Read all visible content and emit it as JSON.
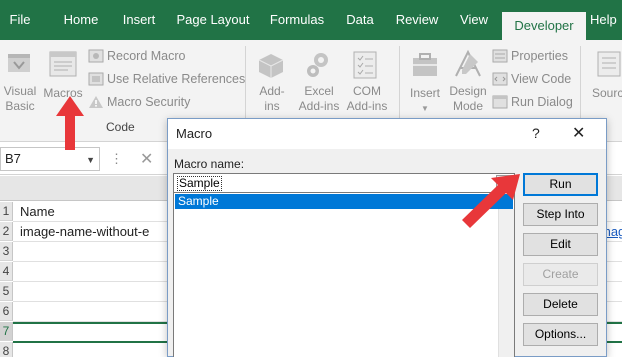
{
  "ribbon_tabs": [
    {
      "label": "File"
    },
    {
      "label": "Home"
    },
    {
      "label": "Insert"
    },
    {
      "label": "Page Layout"
    },
    {
      "label": "Formulas"
    },
    {
      "label": "Data"
    },
    {
      "label": "Review"
    },
    {
      "label": "View"
    },
    {
      "label": "Developer",
      "active": true
    },
    {
      "label": "Help"
    }
  ],
  "ribbon": {
    "visual_basic": "Visual Basic",
    "visual_basic_l1": "Visual",
    "visual_basic_l2": "Basic",
    "macros": "Macros",
    "record_macro": "Record Macro",
    "use_relative_references": "Use Relative References",
    "macro_security": "Macro Security",
    "code_group_label": "Code",
    "addins_l1": "Add-",
    "addins_l2": "ins",
    "excel_addins_l1": "Excel",
    "excel_addins_l2": "Add-ins",
    "com_addins_l1": "COM",
    "com_addins_l2": "Add-ins",
    "insert": "Insert",
    "design_mode_l1": "Design",
    "design_mode_l2": "Mode",
    "properties": "Properties",
    "view_code": "View Code",
    "run_dialog": "Run Dialog",
    "source_partial": "Sourc"
  },
  "formula_bar": {
    "name_box": "B7",
    "dots": "⋮",
    "cancel_glyph": "✕"
  },
  "sheet": {
    "rows": [
      {
        "num": "1",
        "a": "Name"
      },
      {
        "num": "2",
        "a": "image-name-without-e",
        "link": "mag"
      },
      {
        "num": "3",
        "a": ""
      },
      {
        "num": "4",
        "a": ""
      },
      {
        "num": "5",
        "a": ""
      },
      {
        "num": "6",
        "a": ""
      },
      {
        "num": "7",
        "a": ""
      },
      {
        "num": "8",
        "a": ""
      }
    ]
  },
  "dialog": {
    "title": "Macro",
    "help": "?",
    "close": "✕",
    "macro_name_label": "Macro name:",
    "macro_name_value": "Sample",
    "list_items": [
      "Sample"
    ],
    "up_button_glyph": "🠕",
    "buttons": {
      "run": "Run",
      "step_into": "Step Into",
      "edit": "Edit",
      "create": "Create",
      "delete": "Delete",
      "options": "Options..."
    }
  },
  "colors": {
    "ribbon_green": "#217346",
    "selection_blue": "#0078d7",
    "annotation_red": "#e8373a"
  }
}
